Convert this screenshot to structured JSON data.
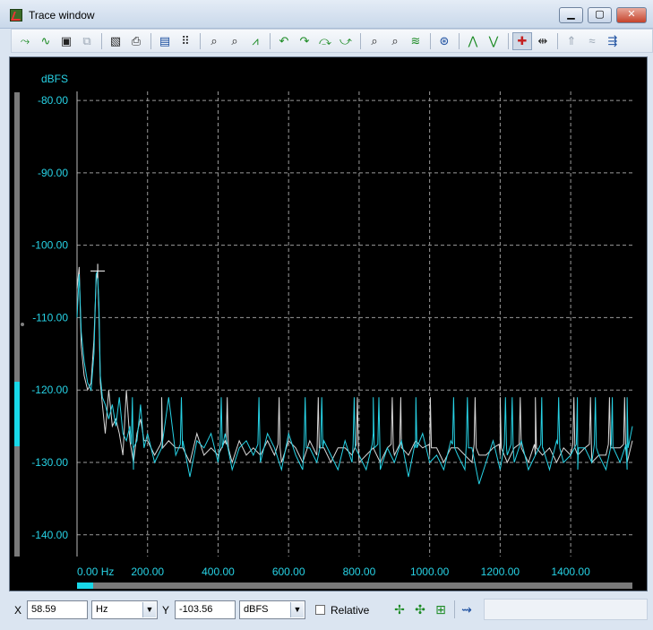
{
  "window": {
    "title": "Trace window"
  },
  "titlebar_buttons": {
    "minimize": "▁",
    "maximize": "▢",
    "close": "✕"
  },
  "toolbar": {
    "groups": [
      [
        "trace-add-icon",
        "trace-sub-icon",
        "save-trace-icon",
        "copy-trace-icon"
      ],
      [
        "overlay-icon",
        "print-icon"
      ],
      [
        "properties-icon",
        "data-table-icon"
      ],
      [
        "zoom-x-icon",
        "zoom-y-icon",
        "autoscale-icon"
      ],
      [
        "peak-left-icon",
        "peak-up-icon",
        "peak-next-icon",
        "peak-right-icon"
      ],
      [
        "zoom-in-icon",
        "zoom-out-icon",
        "fit-icon"
      ],
      [
        "measure-icon"
      ],
      [
        "marker-up-icon",
        "marker-down-icon"
      ],
      [
        "cursor-mode-icon",
        "step-icon"
      ],
      [
        "disabled-a-icon",
        "disabled-b-icon",
        "markers-icon"
      ]
    ]
  },
  "chart_data": {
    "type": "line",
    "ylabel": "dBFS",
    "xlim": [
      0,
      1575
    ],
    "ylim": [
      -143,
      -79
    ],
    "yticks": [
      -80,
      -90,
      -100,
      -110,
      -120,
      -130,
      -140
    ],
    "ytick_labels": [
      "-80.00",
      "-90.00",
      "-100.00",
      "-110.00",
      "-120.00",
      "-130.00",
      "-140.00"
    ],
    "xticks": [
      0,
      200,
      400,
      600,
      800,
      1000,
      1200,
      1400
    ],
    "xtick_labels": [
      "0.00 Hz",
      "200.00",
      "400.00",
      "600.00",
      "800.00",
      "1000.00",
      "1200.00",
      "1400.00"
    ],
    "grid": true,
    "cursor": {
      "x": 58.59,
      "y": -103.56
    },
    "series": [
      {
        "color": "#27d3e6",
        "x": [
          0,
          6,
          12,
          20,
          30,
          40,
          48,
          54,
          58,
          62,
          66,
          72,
          80,
          90,
          100,
          110,
          120,
          130,
          140,
          150,
          160,
          170,
          180,
          190,
          200,
          220,
          240,
          260,
          280,
          300,
          320,
          340,
          360,
          380,
          400,
          420,
          440,
          460,
          480,
          500,
          520,
          540,
          560,
          580,
          600,
          620,
          640,
          660,
          680,
          700,
          720,
          740,
          760,
          780,
          800,
          820,
          840,
          860,
          880,
          900,
          920,
          940,
          960,
          980,
          1000,
          1020,
          1040,
          1060,
          1080,
          1100,
          1120,
          1140,
          1160,
          1180,
          1200,
          1220,
          1240,
          1260,
          1280,
          1300,
          1320,
          1340,
          1360,
          1380,
          1400,
          1420,
          1440,
          1460,
          1480,
          1500,
          1520,
          1540,
          1560,
          1575
        ],
        "values": [
          -110,
          -104,
          -112,
          -116,
          -119,
          -120,
          -115,
          -104,
          -103.6,
          -108,
          -118,
          -121,
          -122,
          -124,
          -122,
          -125,
          -121,
          -126,
          -127,
          -125,
          -131,
          -127,
          -122,
          -128,
          -126,
          -130,
          -128,
          -121,
          -129,
          -127,
          -132,
          -127,
          -128,
          -126,
          -130,
          -126,
          -131,
          -128,
          -127,
          -129,
          -130,
          -126,
          -128,
          -131,
          -126,
          -129,
          -131,
          -128,
          -130,
          -127,
          -129,
          -131,
          -127,
          -130,
          -129,
          -131,
          -126,
          -131,
          -128,
          -130,
          -127,
          -132,
          -128,
          -126,
          -130,
          -129,
          -131,
          -127,
          -129,
          -131,
          -128,
          -133,
          -130,
          -127,
          -131,
          -129,
          -130,
          -127,
          -131,
          -129,
          -128,
          -131,
          -127,
          -130,
          -129,
          -131,
          -128,
          -130,
          -129,
          -131,
          -128,
          -130,
          -131,
          -125
        ]
      },
      {
        "color": "#d8d8d8",
        "x": [
          0,
          6,
          12,
          20,
          30,
          40,
          48,
          54,
          58,
          62,
          66,
          72,
          80,
          90,
          100,
          110,
          120,
          130,
          140,
          150,
          160,
          170,
          180,
          190,
          200,
          220,
          240,
          260,
          280,
          300,
          320,
          340,
          360,
          380,
          400,
          420,
          440,
          460,
          480,
          500,
          520,
          540,
          560,
          580,
          600,
          620,
          640,
          660,
          680,
          700,
          720,
          740,
          760,
          780,
          800,
          820,
          840,
          860,
          880,
          900,
          920,
          940,
          960,
          980,
          1000,
          1020,
          1040,
          1060,
          1080,
          1100,
          1120,
          1140,
          1160,
          1180,
          1200,
          1220,
          1240,
          1260,
          1280,
          1300,
          1320,
          1340,
          1360,
          1380,
          1400,
          1420,
          1440,
          1460,
          1480,
          1500,
          1520,
          1540,
          1560,
          1575
        ],
        "values": [
          -106,
          -103,
          -114,
          -118,
          -120,
          -119,
          -113,
          -105,
          -103.5,
          -109,
          -119,
          -122,
          -126,
          -120,
          -125,
          -124,
          -126,
          -129,
          -120,
          -127,
          -130,
          -126,
          -124,
          -127,
          -127,
          -129,
          -127,
          -127,
          -128,
          -128,
          -130,
          -126,
          -129,
          -128,
          -129,
          -127,
          -130,
          -127,
          -129,
          -128,
          -129,
          -127,
          -129,
          -130,
          -127,
          -128,
          -130,
          -127,
          -129,
          -128,
          -130,
          -128,
          -128,
          -129,
          -130,
          -129,
          -128,
          -130,
          -128,
          -129,
          -128,
          -129,
          -127,
          -128,
          -129,
          -128,
          -130,
          -128,
          -128,
          -129,
          -130,
          -129,
          -129,
          -128,
          -129,
          -130,
          -128,
          -128,
          -130,
          -129,
          -129,
          -128,
          -130,
          -128,
          -129,
          -129,
          -128,
          -130,
          -129,
          -129,
          -128,
          -128,
          -130,
          -127
        ]
      }
    ],
    "spikes": {
      "cyan": [
        157,
        296,
        409,
        516,
        647,
        694,
        786,
        840,
        856,
        961,
        1068,
        1107,
        1215,
        1234,
        1318,
        1366,
        1419,
        1470,
        1518,
        1560
      ],
      "white": [
        240,
        426,
        573,
        684,
        795,
        894,
        918,
        1002,
        1129,
        1200,
        1257,
        1300,
        1409,
        1456,
        1510,
        1553
      ]
    }
  },
  "statusbar": {
    "x_label": "X",
    "x_value": "58.59",
    "x_unit": "Hz",
    "y_label": "Y",
    "y_value": "-103.56",
    "y_unit": "dBFS",
    "relative_label": "Relative",
    "relative_checked": false
  }
}
